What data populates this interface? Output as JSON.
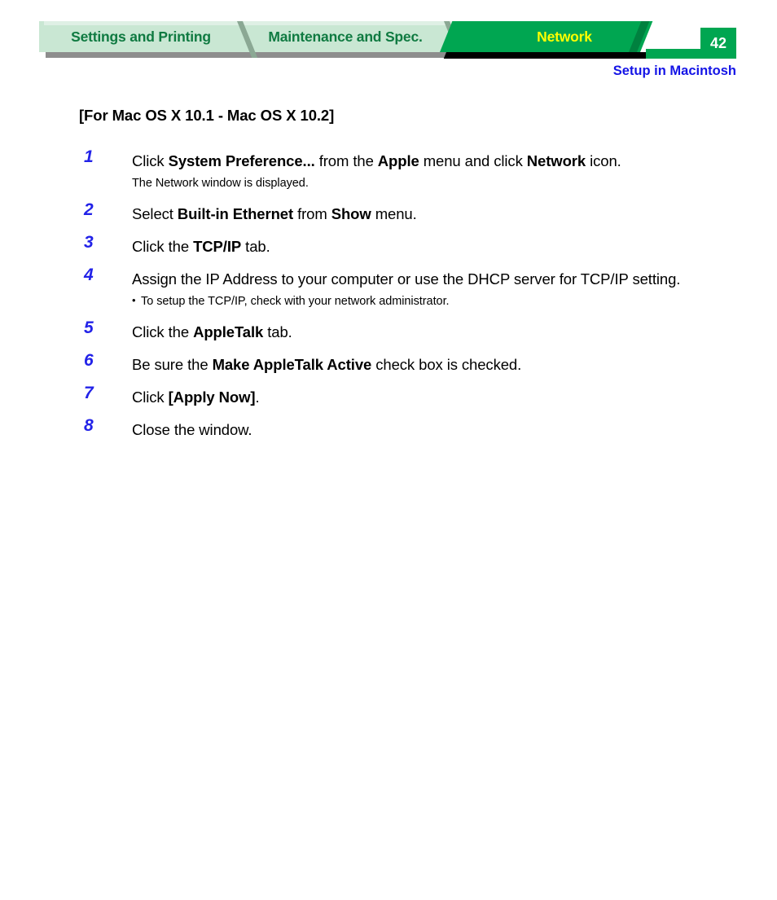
{
  "header": {
    "tabs": [
      {
        "label": "Settings and Printing",
        "active": false
      },
      {
        "label": "Maintenance and Spec.",
        "active": false
      },
      {
        "label": "Network",
        "active": true
      }
    ],
    "page_number": "42",
    "subtitle": "Setup in Macintosh",
    "colors": {
      "tab_inactive_bg": "#c9e7d3",
      "tab_inactive_text": "#0f7a41",
      "tab_active_bg": "#00a651",
      "tab_active_text": "#ffff00",
      "page_box_bg": "#00a651",
      "page_box_text": "#ffffff",
      "subtitle_text": "#1414e6",
      "shadow_gray": "#8d8d8d",
      "shadow_black": "#000000",
      "step_number": "#2222e8"
    }
  },
  "main": {
    "section_heading": "[For Mac OS X 10.1 - Mac OS X 10.2]",
    "steps": [
      {
        "number": "1",
        "parts": [
          {
            "text": "Click ",
            "bold": false
          },
          {
            "text": "System Preference...",
            "bold": true
          },
          {
            "text": " from the ",
            "bold": false
          },
          {
            "text": "Apple",
            "bold": true
          },
          {
            "text": " menu and click ",
            "bold": false
          },
          {
            "text": "Network",
            "bold": true
          },
          {
            "text": " icon.",
            "bold": false
          }
        ],
        "note": "The Network window is displayed.",
        "note_bullet": false
      },
      {
        "number": "2",
        "parts": [
          {
            "text": "Select ",
            "bold": false
          },
          {
            "text": "Built-in Ethernet",
            "bold": true
          },
          {
            "text": " from ",
            "bold": false
          },
          {
            "text": "Show",
            "bold": true
          },
          {
            "text": " menu.",
            "bold": false
          }
        ],
        "note": "",
        "note_bullet": false
      },
      {
        "number": "3",
        "parts": [
          {
            "text": "Click the ",
            "bold": false
          },
          {
            "text": "TCP/IP",
            "bold": true
          },
          {
            "text": " tab.",
            "bold": false
          }
        ],
        "note": "",
        "note_bullet": false
      },
      {
        "number": "4",
        "parts": [
          {
            "text": "Assign the IP Address to your computer or use the DHCP server for TCP/IP setting.",
            "bold": false
          }
        ],
        "note": "To setup the TCP/IP, check with your network administrator.",
        "note_bullet": true
      },
      {
        "number": "5",
        "parts": [
          {
            "text": "Click the ",
            "bold": false
          },
          {
            "text": "AppleTalk",
            "bold": true
          },
          {
            "text": " tab.",
            "bold": false
          }
        ],
        "note": "",
        "note_bullet": false
      },
      {
        "number": "6",
        "parts": [
          {
            "text": "Be sure the ",
            "bold": false
          },
          {
            "text": "Make AppleTalk Active",
            "bold": true
          },
          {
            "text": " check box is checked.",
            "bold": false
          }
        ],
        "note": "",
        "note_bullet": false
      },
      {
        "number": "7",
        "parts": [
          {
            "text": "Click ",
            "bold": false
          },
          {
            "text": "[Apply Now]",
            "bold": true
          },
          {
            "text": ".",
            "bold": false
          }
        ],
        "note": "",
        "note_bullet": false
      },
      {
        "number": "8",
        "parts": [
          {
            "text": "Close the window.",
            "bold": false
          }
        ],
        "note": "",
        "note_bullet": false
      }
    ]
  }
}
